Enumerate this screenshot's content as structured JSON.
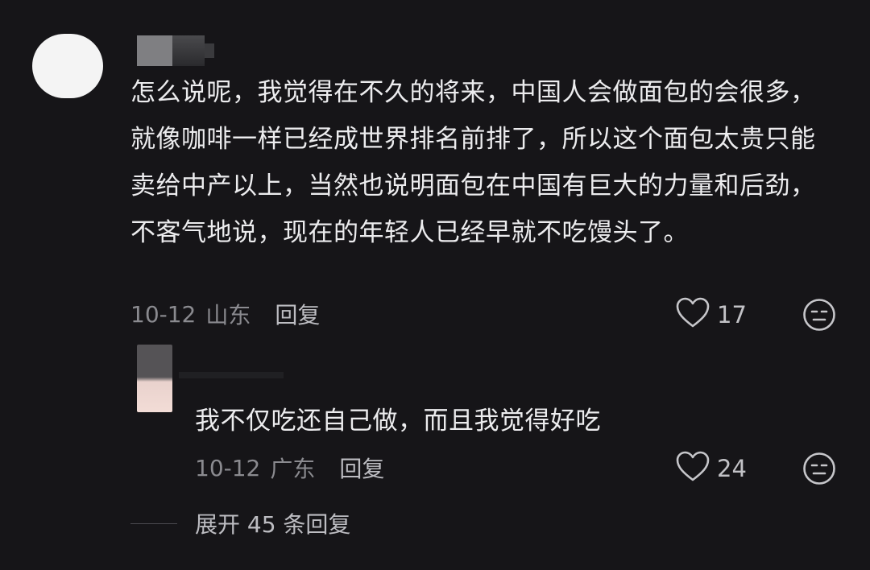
{
  "comment": {
    "text": "怎么说呢，我觉得在不久的将来，中国人会做面包的会很多，就像咖啡一样已经成世界排名前排了，所以这个面包太贵只能卖给中产以上，当然也说明面包在中国有巨大的力量和后劲，不客气地说，现在的年轻人已经早就不吃馒头了。",
    "date": "10-12",
    "location": "山东",
    "reply_label": "回复",
    "likes": "17",
    "like_icon": "heart-icon",
    "dislike_icon": "neutral-face-icon"
  },
  "reply": {
    "text": "我不仅吃还自己做，而且我觉得好吃",
    "date": "10-12",
    "location": "广东",
    "reply_label": "回复",
    "likes": "24",
    "like_icon": "heart-icon",
    "dislike_icon": "neutral-face-icon"
  },
  "expand": {
    "label": "展开 45 条回复"
  },
  "colors": {
    "background": "#161518",
    "text": "#ececee",
    "meta": "#8a8a8f"
  }
}
